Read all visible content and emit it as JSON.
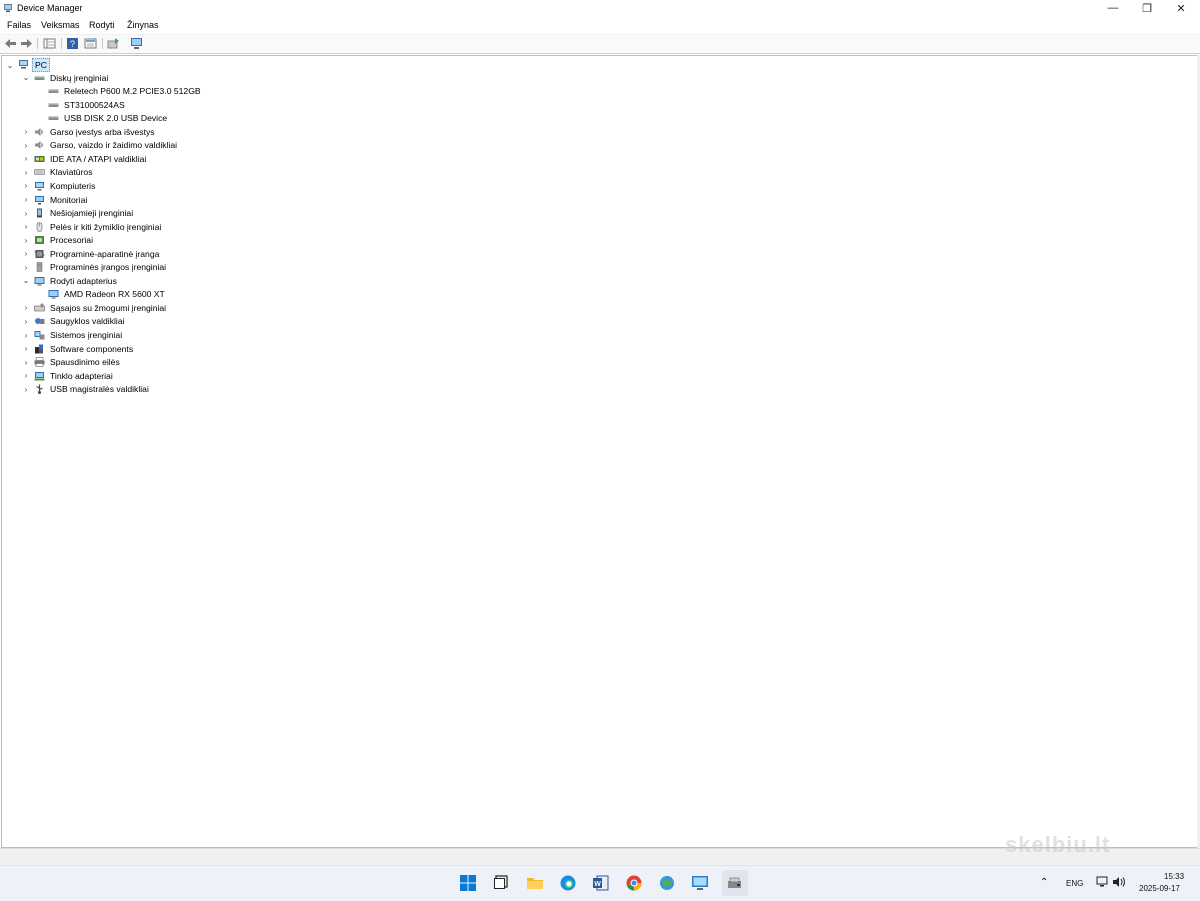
{
  "window": {
    "title": "Device Manager",
    "controls": {
      "minimize": "—",
      "restore": "❐",
      "close": "✕"
    }
  },
  "menu": [
    "Failas",
    "Veiksmas",
    "Rodyti",
    "Žinynas"
  ],
  "tree": {
    "root": "PC",
    "nodes": [
      {
        "label": "Diskų įrenginiai",
        "expanded": true,
        "icon": "disk-drive-icon",
        "children": [
          {
            "label": "Reletech P600 M.2 PCIE3.0 512GB",
            "icon": "disk-drive-icon"
          },
          {
            "label": "ST31000524AS",
            "icon": "disk-drive-icon"
          },
          {
            "label": "USB DISK 2.0 USB Device",
            "icon": "disk-drive-icon"
          }
        ]
      },
      {
        "label": "Garso įvestys arba išvestys",
        "icon": "speaker-icon"
      },
      {
        "label": "Garso, vaizdo ir žaidimo valdikliai",
        "icon": "speaker-icon"
      },
      {
        "label": "IDE ATA / ATAPI valdikliai",
        "icon": "ide-controller-icon"
      },
      {
        "label": "Klaviatūros",
        "icon": "keyboard-icon"
      },
      {
        "label": "Kompiuteris",
        "icon": "computer-icon"
      },
      {
        "label": "Monitoriai",
        "icon": "monitor-icon"
      },
      {
        "label": "Nešiojamieji įrenginiai",
        "icon": "portable-device-icon"
      },
      {
        "label": "Pelės ir kiti žymiklio įrenginiai",
        "icon": "mouse-icon"
      },
      {
        "label": "Procesoriai",
        "icon": "processor-icon"
      },
      {
        "label": "Programinė-aparatinė įranga",
        "icon": "firmware-icon"
      },
      {
        "label": "Programinės įrangos įrenginiai",
        "icon": "software-device-icon"
      },
      {
        "label": "Rodyti adapterius",
        "expanded": true,
        "icon": "display-adapter-icon",
        "children": [
          {
            "label": "AMD Radeon RX 5600 XT",
            "icon": "display-adapter-icon"
          }
        ]
      },
      {
        "label": "Sąsajos su žmogumi įrenginiai",
        "icon": "hid-icon"
      },
      {
        "label": "Saugyklos valdikliai",
        "icon": "storage-controller-icon"
      },
      {
        "label": "Sistemos įrenginiai",
        "icon": "system-device-icon"
      },
      {
        "label": "Software components",
        "icon": "software-component-icon"
      },
      {
        "label": "Spausdinimo eilės",
        "icon": "printer-icon"
      },
      {
        "label": "Tinklo adapteriai",
        "icon": "network-adapter-icon"
      },
      {
        "label": "USB magistralės valdikliai",
        "icon": "usb-icon"
      }
    ]
  },
  "tray": {
    "language": "ENG",
    "time": "15:33",
    "date": "2025-09-17"
  },
  "watermark": "skelbiu.lt",
  "colors": {
    "selection": "#cce8ff",
    "taskbar": "#eef1f7",
    "accent": "#0078d4"
  }
}
